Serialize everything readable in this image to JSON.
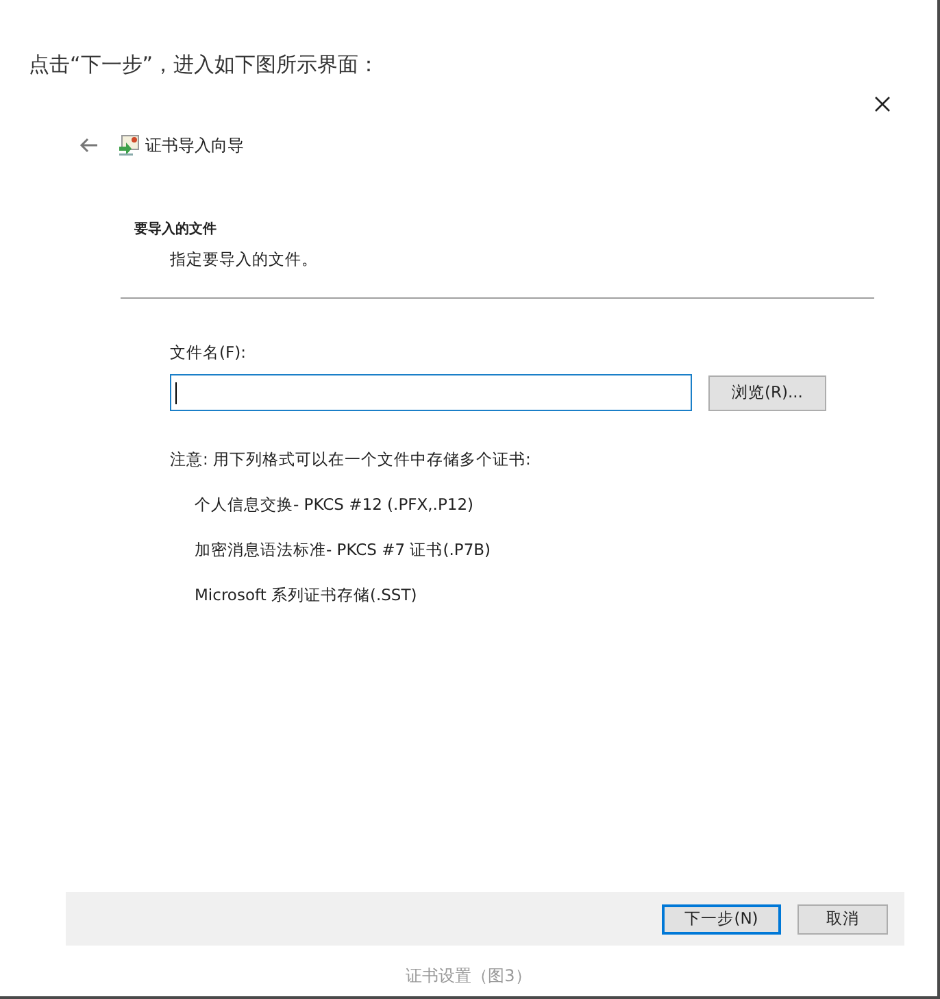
{
  "intro": "点击“下一步”，进入如下图所示界面：",
  "dialog": {
    "title": "证书导入向导",
    "heading": "要导入的文件",
    "subheading": "指定要导入的文件。",
    "file_label": "文件名(F):",
    "file_field": {
      "focused": true
    },
    "browse_button": "浏览(R)...",
    "note": "注意: 用下列格式可以在一个文件中存储多个证书:",
    "formats": [
      "个人信息交换- PKCS #12 (.PFX,.P12)",
      "加密消息语法标准- PKCS #7 证书(.P7B)",
      "Microsoft 系列证书存储(.SST)"
    ],
    "buttons": [
      {
        "label": "下一步(N)",
        "kind": "default"
      },
      {
        "label": "取消",
        "kind": "normal"
      }
    ]
  },
  "caption": "证书设置（图3）"
}
